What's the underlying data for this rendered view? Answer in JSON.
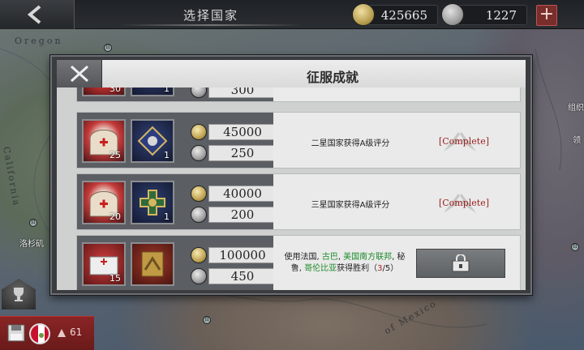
{
  "header": {
    "title": "选择国家",
    "gold_amount": "425665",
    "medal_amount": "1227",
    "add_label": "+"
  },
  "map": {
    "labels": [
      "Oregon",
      "California",
      "of Mexico"
    ],
    "city": "洛杉矶",
    "right_labels": [
      "组织",
      "领"
    ],
    "markers": [
      "II",
      "II",
      "II",
      "II"
    ]
  },
  "modal": {
    "title": "征服成就",
    "rows": [
      {
        "badges": [
          "30",
          "1"
        ],
        "gold": "",
        "medal": "300",
        "desc": "",
        "status": ""
      },
      {
        "badges": [
          "25",
          "1"
        ],
        "gold": "45000",
        "medal": "250",
        "desc": "二星国家获得A级评分",
        "status": "[Complete]"
      },
      {
        "badges": [
          "20",
          "1"
        ],
        "gold": "40000",
        "medal": "200",
        "desc": "三星国家获得A级评分",
        "status": "[Complete]"
      },
      {
        "badges": [
          "15",
          ""
        ],
        "gold": "100000",
        "medal": "450",
        "desc_parts": {
          "p1": "使用法国, ",
          "p2": "古巴",
          "p3": ", ",
          "p4": "美国南方联邦",
          "p5": ", 秘",
          "p6": "鲁, ",
          "p7": "哥伦比亚",
          "p8": "获得胜利（",
          "p9": "3",
          "p10": "/5）"
        },
        "status": ""
      }
    ]
  },
  "hud": {
    "unit_count": "61"
  },
  "colors": {
    "complete": "#9a1d1d",
    "highlight_green": "#1f8a2c",
    "modal_header": "#ecedec"
  }
}
